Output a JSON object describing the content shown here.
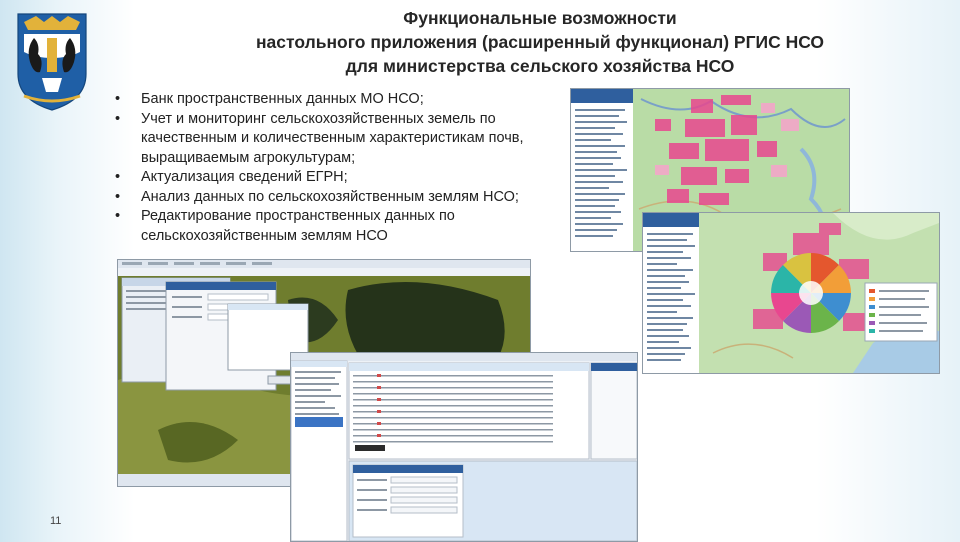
{
  "slide": {
    "title_lines": [
      "Функциональные возможности",
      "настольного приложения (расширенный функционал) РГИС НСО",
      "для министерства сельского хозяйства НСО"
    ],
    "bullets": [
      "Банк пространственных данных МО НСО;",
      "Учет и мониторинг сельскохозяйственных земель по качественным и количественным характеристикам почв, выращиваемым агрокультурам;",
      "Актуализация сведений ЕГРН;",
      "Анализ данных по сельскохозяйственным землям НСО;",
      "Редактирование пространственных данных по сельскохозяйственным землям НСО"
    ],
    "page_number": "11"
  },
  "emblem": {
    "name": "novosibirsk-region-coat-of-arms"
  },
  "screenshots": [
    {
      "name": "web-map-agricultural-lands"
    },
    {
      "name": "web-map-district-sectors"
    },
    {
      "name": "desktop-app-satellite-view"
    },
    {
      "name": "desktop-app-attribute-table"
    }
  ],
  "colors": {
    "title_text": "#262626",
    "emblem_blue": "#1f5fa6",
    "emblem_gold": "#e2b23a",
    "map_green": "#b9dca6",
    "map_parcel_pink": "#e8478f",
    "app_panel_blue": "#d8e6f4"
  }
}
